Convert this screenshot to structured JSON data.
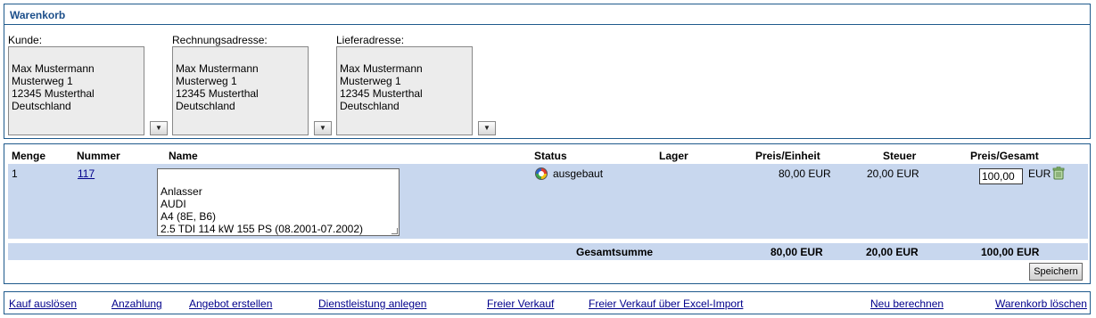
{
  "cart": {
    "title": "Warenkorb",
    "addresses": [
      {
        "label": "Kunde:",
        "text": "Max Mustermann\nMusterweg 1\n12345 Musterthal\nDeutschland"
      },
      {
        "label": "Rechnungsadresse:",
        "text": "Max Mustermann\nMusterweg 1\n12345 Musterthal\nDeutschland"
      },
      {
        "label": "Lieferadresse:",
        "text": "Max Mustermann\nMusterweg 1\n12345 Musterthal\nDeutschland"
      }
    ],
    "dropdown_glyph": "▼"
  },
  "items": {
    "headers": {
      "menge": "Menge",
      "nummer": "Nummer",
      "name": "Name",
      "status": "Status",
      "lager": "Lager",
      "preis_einheit": "Preis/Einheit",
      "steuer": "Steuer",
      "preis_gesamt": "Preis/Gesamt"
    },
    "row": {
      "menge": "1",
      "nummer": "117",
      "name": "Anlasser\nAUDI\nA4 (8E, B6)\n2.5 TDI  114 kW  155 PS (08.2001-07.2002)",
      "status_icon": "status-wheel-icon",
      "status": "ausgebaut",
      "preis_einheit": "80,00 EUR",
      "steuer": "20,00 EUR",
      "preis_gesamt_value": "100,00",
      "currency": "EUR",
      "delete_icon": "trash-icon"
    },
    "totals": {
      "label": "Gesamtsumme",
      "preis_einheit": "80,00 EUR",
      "steuer": "20,00 EUR",
      "preis_gesamt": "100,00 EUR"
    },
    "save_label": "Speichern"
  },
  "footer": {
    "links": [
      "Kauf auslösen",
      "Anzahlung",
      "Angebot erstellen",
      "Dienstleistung anlegen",
      "Freier Verkauf",
      "Freier Verkauf über Excel-Import",
      "Neu berechnen",
      "Warenkorb löschen"
    ]
  },
  "colors": {
    "border": "#1f5a8c",
    "title": "#1b4e8a",
    "row_highlight": "#c8d7ee"
  }
}
